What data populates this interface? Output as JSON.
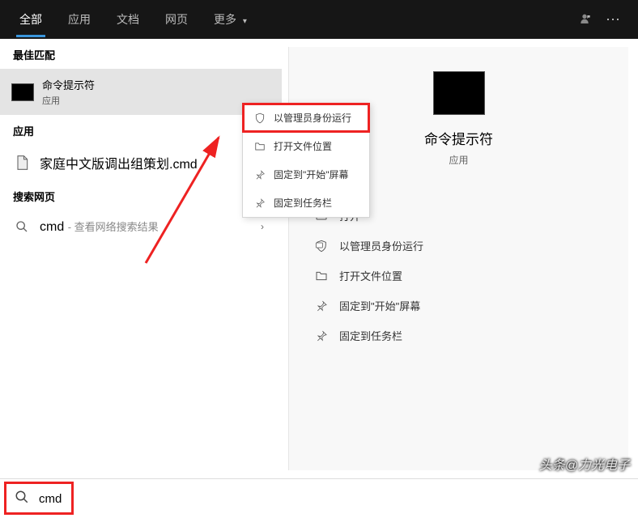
{
  "tabs": {
    "all": "全部",
    "apps": "应用",
    "docs": "文档",
    "web": "网页",
    "more": "更多"
  },
  "sections": {
    "best_match": "最佳匹配",
    "apps": "应用",
    "search_web": "搜索网页"
  },
  "best_match": {
    "title": "命令提示符",
    "subtitle": "应用"
  },
  "apps_result": {
    "title": "家庭中文版调出组策划.cmd"
  },
  "web_result": {
    "prefix": "cmd",
    "suffix": "查看网络搜索结果"
  },
  "context_menu": {
    "run_admin": "以管理员身份运行",
    "open_location": "打开文件位置",
    "pin_start": "固定到\"开始\"屏幕",
    "pin_taskbar": "固定到任务栏"
  },
  "preview": {
    "title": "命令提示符",
    "subtitle": "应用"
  },
  "actions": {
    "open": "打开",
    "run_admin": "以管理员身份运行",
    "open_location": "打开文件位置",
    "pin_start": "固定到\"开始\"屏幕",
    "pin_taskbar": "固定到任务栏"
  },
  "search": {
    "value": "cmd"
  },
  "watermark": "头条@力光电子"
}
